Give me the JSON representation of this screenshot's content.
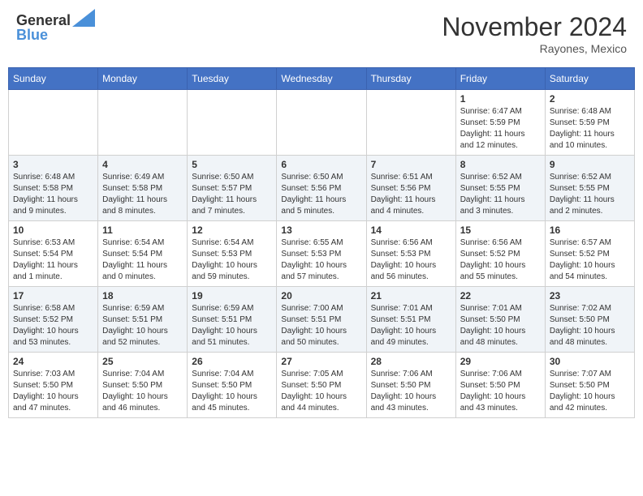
{
  "header": {
    "logo_line1": "General",
    "logo_line2": "Blue",
    "month_title": "November 2024",
    "location": "Rayones, Mexico"
  },
  "weekdays": [
    "Sunday",
    "Monday",
    "Tuesday",
    "Wednesday",
    "Thursday",
    "Friday",
    "Saturday"
  ],
  "weeks": [
    [
      {
        "day": "",
        "info": ""
      },
      {
        "day": "",
        "info": ""
      },
      {
        "day": "",
        "info": ""
      },
      {
        "day": "",
        "info": ""
      },
      {
        "day": "",
        "info": ""
      },
      {
        "day": "1",
        "info": "Sunrise: 6:47 AM\nSunset: 5:59 PM\nDaylight: 11 hours and 12 minutes."
      },
      {
        "day": "2",
        "info": "Sunrise: 6:48 AM\nSunset: 5:59 PM\nDaylight: 11 hours and 10 minutes."
      }
    ],
    [
      {
        "day": "3",
        "info": "Sunrise: 6:48 AM\nSunset: 5:58 PM\nDaylight: 11 hours and 9 minutes."
      },
      {
        "day": "4",
        "info": "Sunrise: 6:49 AM\nSunset: 5:58 PM\nDaylight: 11 hours and 8 minutes."
      },
      {
        "day": "5",
        "info": "Sunrise: 6:50 AM\nSunset: 5:57 PM\nDaylight: 11 hours and 7 minutes."
      },
      {
        "day": "6",
        "info": "Sunrise: 6:50 AM\nSunset: 5:56 PM\nDaylight: 11 hours and 5 minutes."
      },
      {
        "day": "7",
        "info": "Sunrise: 6:51 AM\nSunset: 5:56 PM\nDaylight: 11 hours and 4 minutes."
      },
      {
        "day": "8",
        "info": "Sunrise: 6:52 AM\nSunset: 5:55 PM\nDaylight: 11 hours and 3 minutes."
      },
      {
        "day": "9",
        "info": "Sunrise: 6:52 AM\nSunset: 5:55 PM\nDaylight: 11 hours and 2 minutes."
      }
    ],
    [
      {
        "day": "10",
        "info": "Sunrise: 6:53 AM\nSunset: 5:54 PM\nDaylight: 11 hours and 1 minute."
      },
      {
        "day": "11",
        "info": "Sunrise: 6:54 AM\nSunset: 5:54 PM\nDaylight: 11 hours and 0 minutes."
      },
      {
        "day": "12",
        "info": "Sunrise: 6:54 AM\nSunset: 5:53 PM\nDaylight: 10 hours and 59 minutes."
      },
      {
        "day": "13",
        "info": "Sunrise: 6:55 AM\nSunset: 5:53 PM\nDaylight: 10 hours and 57 minutes."
      },
      {
        "day": "14",
        "info": "Sunrise: 6:56 AM\nSunset: 5:53 PM\nDaylight: 10 hours and 56 minutes."
      },
      {
        "day": "15",
        "info": "Sunrise: 6:56 AM\nSunset: 5:52 PM\nDaylight: 10 hours and 55 minutes."
      },
      {
        "day": "16",
        "info": "Sunrise: 6:57 AM\nSunset: 5:52 PM\nDaylight: 10 hours and 54 minutes."
      }
    ],
    [
      {
        "day": "17",
        "info": "Sunrise: 6:58 AM\nSunset: 5:52 PM\nDaylight: 10 hours and 53 minutes."
      },
      {
        "day": "18",
        "info": "Sunrise: 6:59 AM\nSunset: 5:51 PM\nDaylight: 10 hours and 52 minutes."
      },
      {
        "day": "19",
        "info": "Sunrise: 6:59 AM\nSunset: 5:51 PM\nDaylight: 10 hours and 51 minutes."
      },
      {
        "day": "20",
        "info": "Sunrise: 7:00 AM\nSunset: 5:51 PM\nDaylight: 10 hours and 50 minutes."
      },
      {
        "day": "21",
        "info": "Sunrise: 7:01 AM\nSunset: 5:51 PM\nDaylight: 10 hours and 49 minutes."
      },
      {
        "day": "22",
        "info": "Sunrise: 7:01 AM\nSunset: 5:50 PM\nDaylight: 10 hours and 48 minutes."
      },
      {
        "day": "23",
        "info": "Sunrise: 7:02 AM\nSunset: 5:50 PM\nDaylight: 10 hours and 48 minutes."
      }
    ],
    [
      {
        "day": "24",
        "info": "Sunrise: 7:03 AM\nSunset: 5:50 PM\nDaylight: 10 hours and 47 minutes."
      },
      {
        "day": "25",
        "info": "Sunrise: 7:04 AM\nSunset: 5:50 PM\nDaylight: 10 hours and 46 minutes."
      },
      {
        "day": "26",
        "info": "Sunrise: 7:04 AM\nSunset: 5:50 PM\nDaylight: 10 hours and 45 minutes."
      },
      {
        "day": "27",
        "info": "Sunrise: 7:05 AM\nSunset: 5:50 PM\nDaylight: 10 hours and 44 minutes."
      },
      {
        "day": "28",
        "info": "Sunrise: 7:06 AM\nSunset: 5:50 PM\nDaylight: 10 hours and 43 minutes."
      },
      {
        "day": "29",
        "info": "Sunrise: 7:06 AM\nSunset: 5:50 PM\nDaylight: 10 hours and 43 minutes."
      },
      {
        "day": "30",
        "info": "Sunrise: 7:07 AM\nSunset: 5:50 PM\nDaylight: 10 hours and 42 minutes."
      }
    ]
  ]
}
